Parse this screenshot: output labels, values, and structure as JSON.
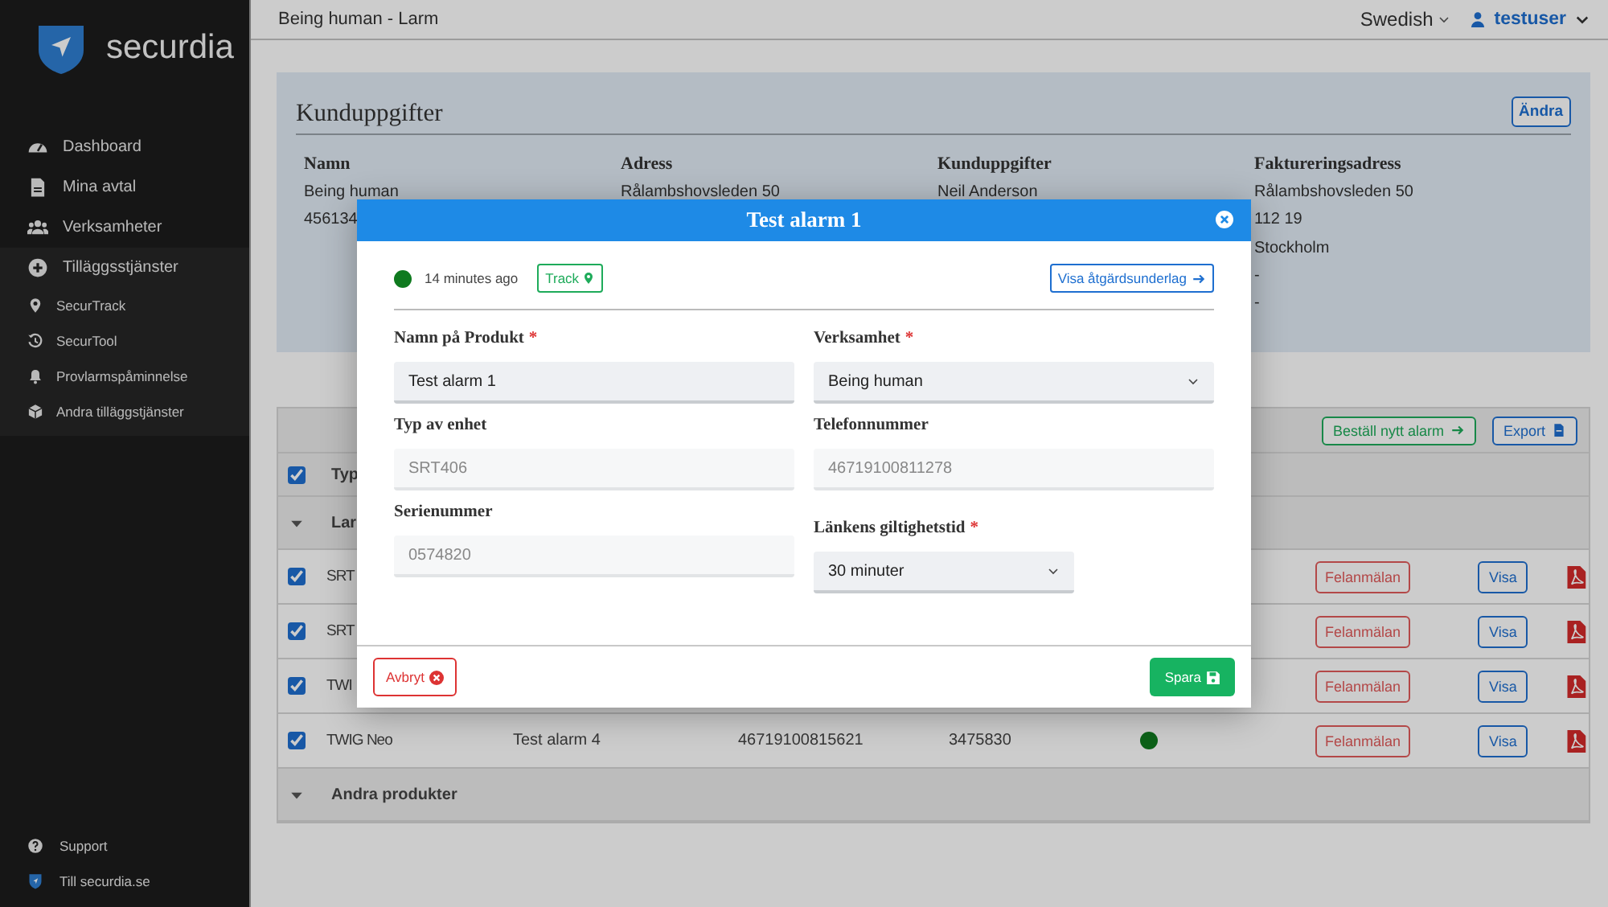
{
  "sidebar": {
    "brand": "securdia",
    "items": [
      {
        "label": "Dashboard"
      },
      {
        "label": "Mina avtal"
      },
      {
        "label": "Verksamheter"
      },
      {
        "label": "Tilläggsstjänster",
        "expanded": true,
        "children": [
          {
            "label": "SecurTrack"
          },
          {
            "label": "SecurTool"
          },
          {
            "label": "Provlarmspåminnelse"
          },
          {
            "label": "Andra tilläggstjänster"
          }
        ]
      }
    ],
    "footer_items": [
      {
        "label": "Support"
      },
      {
        "label": "Till securdia.se"
      }
    ]
  },
  "topbar": {
    "title": "Being human - Larm",
    "language": "Swedish",
    "user": "testuser"
  },
  "customer_card": {
    "title": "Kunduppgifter",
    "edit_button": "Ändra",
    "columns": [
      {
        "heading": "Namn",
        "lines": [
          "Being human",
          "456134"
        ]
      },
      {
        "heading": "Adress",
        "lines": [
          "Rålambshovsleden 50"
        ]
      },
      {
        "heading": "Kunduppgifter",
        "lines": [
          "Neil Anderson"
        ]
      },
      {
        "heading": "Faktureringsadress",
        "lines": [
          "Rålambshovsleden 50",
          "112 19",
          "Stockholm",
          "-",
          "-"
        ]
      }
    ]
  },
  "table": {
    "buttons": [
      "Beställ nytt alarm",
      "Export"
    ],
    "header_checked": true,
    "header": "Typ",
    "groups": [
      {
        "label": "Lar",
        "rows": [
          {
            "checked": true,
            "type": "SRT",
            "actions": [
              "Felanmälan",
              "Visa"
            ]
          },
          {
            "checked": true,
            "type": "SRT",
            "actions": [
              "Felanmälan",
              "Visa"
            ]
          },
          {
            "checked": true,
            "type": "TWI",
            "actions": [
              "Felanmälan",
              "Visa"
            ]
          },
          {
            "checked": true,
            "type": "TWIG Neo",
            "name": "Test alarm 4",
            "phone": "46719100815621",
            "serial": "3475830",
            "online": true,
            "actions": [
              "Felanmälan",
              "Visa"
            ]
          }
        ]
      },
      {
        "label": "Andra produkter"
      }
    ]
  },
  "modal": {
    "title": "Test alarm 1",
    "online": true,
    "time": "14 minutes ago",
    "track_button": "Track",
    "report_button": "Visa åtgärdsunderlag",
    "fields": [
      {
        "label": "Namn på Produkt",
        "required_mark": "*",
        "kind": "text",
        "value": "Test alarm 1",
        "disabled": false
      },
      {
        "label": "Verksamhet",
        "required_mark": "*",
        "kind": "select",
        "value": "Being human",
        "disabled": false
      },
      {
        "label": "Typ av enhet",
        "kind": "text",
        "value": "SRT406",
        "disabled": true
      },
      {
        "label": "Telefonnummer",
        "kind": "text",
        "value": "46719100811278",
        "disabled": true
      },
      {
        "label": "Serienummer",
        "kind": "text",
        "value": "0574820",
        "disabled": true
      },
      {
        "label": "Länkens giltighetstid",
        "required_mark": "*",
        "kind": "select",
        "value": "30 minuter",
        "disabled": false
      }
    ],
    "cancel_button": "Avbryt",
    "save_button": "Spara"
  }
}
